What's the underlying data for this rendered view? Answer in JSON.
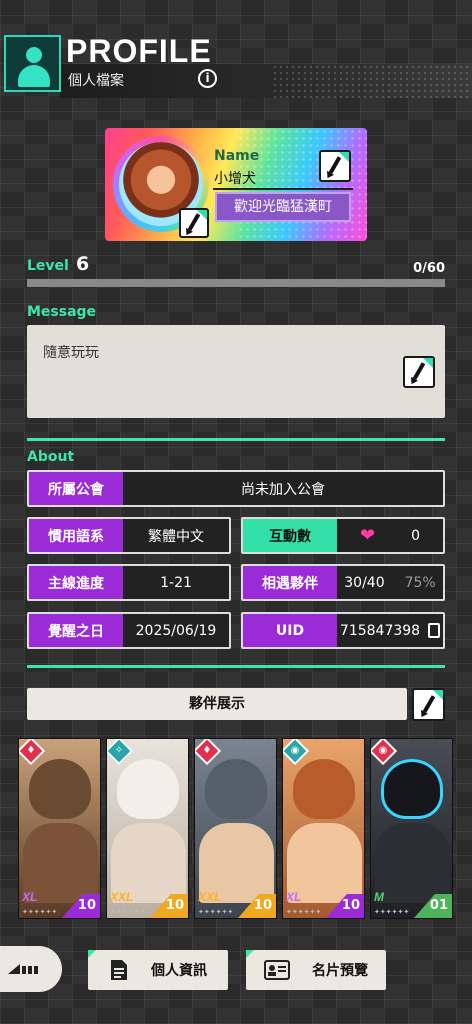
{
  "header": {
    "title": "PROFILE",
    "subtitle": "個人檔案",
    "info_icon": "i"
  },
  "profile_card": {
    "name_label": "Name",
    "name_value": "小增犬",
    "title_badge": "歡迎光臨猛漢町"
  },
  "level": {
    "label": "Level",
    "value": "6",
    "progress_text": "0/60",
    "progress_fraction": 0.0
  },
  "message": {
    "label": "Message",
    "text": "隨意玩玩"
  },
  "about": {
    "label": "About",
    "guild_key": "所屬公會",
    "guild_val": "尚未加入公會",
    "lang_key": "慣用語系",
    "lang_val": "繁體中文",
    "interact_key": "互動數",
    "interact_val": "0",
    "heart_icon": "❤",
    "progress_key": "主線進度",
    "progress_val": "1-21",
    "partner_key": "相遇夥伴",
    "partner_val": "30/40",
    "partner_pct": "75%",
    "awaken_key": "覺醒之日",
    "awaken_val": "2025/06/19",
    "uid_key": "UID",
    "uid_val": "715847398"
  },
  "showcase": {
    "title": "夥伴展示",
    "partners": [
      {
        "size": "XL",
        "level": "10",
        "stars": "✦✦✦✦✦✦",
        "element_icon": "fire-icon"
      },
      {
        "size": "XXL",
        "level": "10",
        "stars": "✦✦✦✦✦✦",
        "element_icon": "wind-icon"
      },
      {
        "size": "XXL",
        "level": "10",
        "stars": "✦✦✦✦✦✦",
        "element_icon": "fire-icon"
      },
      {
        "size": "XL",
        "level": "10",
        "stars": "✦✦✦✦✦✦",
        "element_icon": "eye-icon"
      },
      {
        "size": "M",
        "level": "01",
        "stars": "✦✦✦✦✦✦",
        "element_icon": "eye-icon"
      }
    ]
  },
  "bottom": {
    "personal_info": "個人資訊",
    "card_preview": "名片預覽"
  },
  "colors": {
    "accent": "#3ee6a8",
    "purple": "#9b2bd6",
    "background": "#2b2b2b"
  }
}
